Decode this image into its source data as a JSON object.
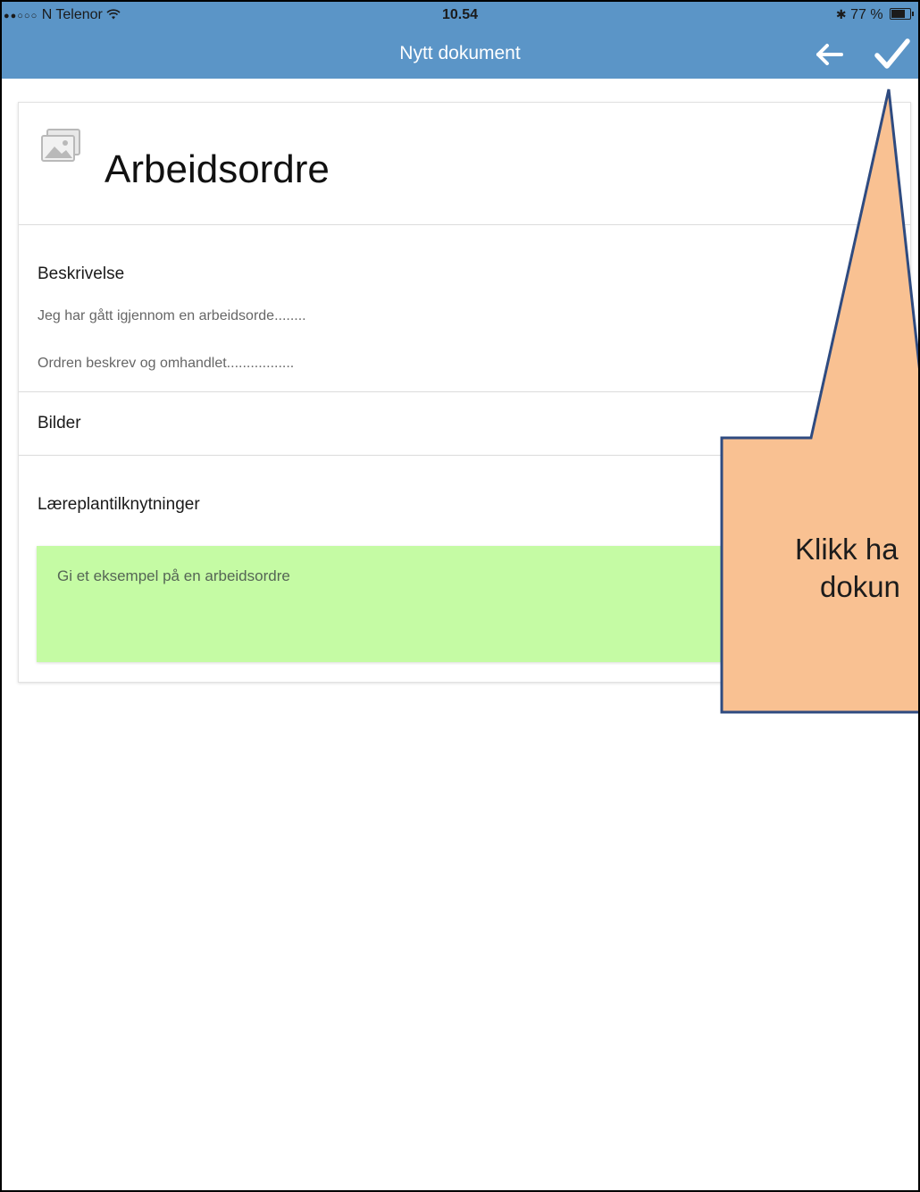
{
  "status_bar": {
    "carrier": "N Telenor",
    "time": "10.54",
    "battery": "77 %"
  },
  "app_bar": {
    "title": "Nytt dokument",
    "icons": [
      "back-arrow-icon",
      "checkmark-icon"
    ],
    "color": "#5b95c7"
  },
  "document": {
    "title": "Arbeidsordre",
    "image_icon": "image-placeholder-icon",
    "sections": {
      "description_label": "Beskrivelse",
      "description_line_1": "Jeg har gått igjennom en arbeidsorde........",
      "description_line_2": "Ordren beskrev og omhandlet.................",
      "images_label": "Bilder",
      "curriculum_label": "Læreplantilknytninger",
      "curriculum_item": "Gi et eksempel på en arbeidsordre"
    },
    "curriculum_color": "#c5fba4"
  },
  "annotation": {
    "line_1": "Klikk ha",
    "line_2": "dokun",
    "fill_color": "#f9c192",
    "border_color": "#2f4b80"
  }
}
